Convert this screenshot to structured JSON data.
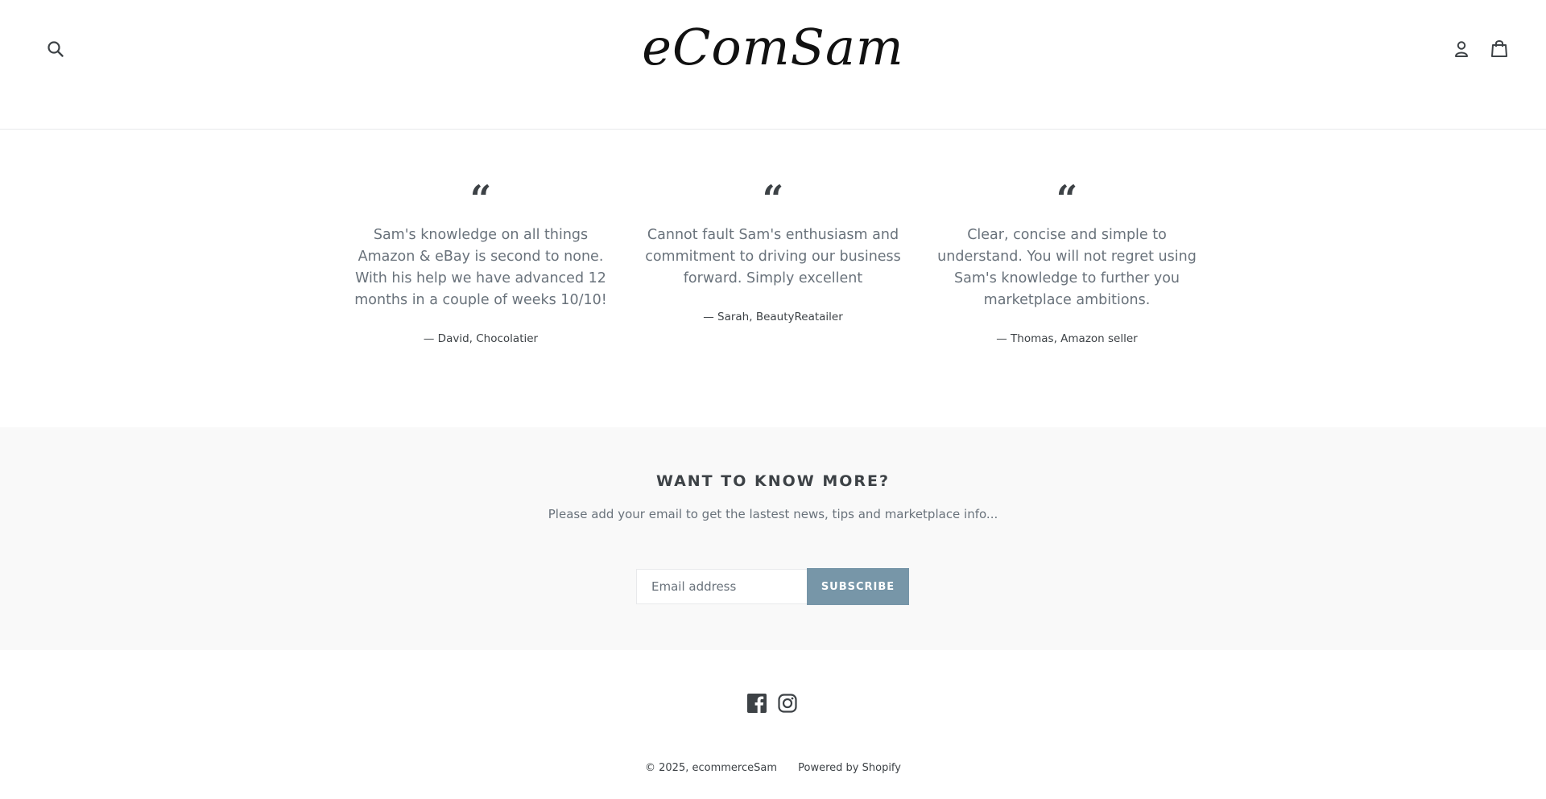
{
  "header": {
    "logo": "eComSam",
    "icons": {
      "search": "search-icon",
      "account": "user-icon",
      "cart": "cart-icon"
    }
  },
  "testimonials": [
    {
      "quote_mark": "“",
      "text": "Sam's knowledge on all things Amazon & eBay is second to none. With his help we have advanced 12 months in a couple of weeks 10/10!",
      "author": "— David, Chocolatier"
    },
    {
      "quote_mark": "“",
      "text": "Cannot fault Sam's enthusiasm and commitment to driving our business forward. Simply excellent",
      "author": "— Sarah, BeautyReatailer"
    },
    {
      "quote_mark": "“",
      "text": "Clear, concise and simple to understand. You will not regret using Sam's knowledge to further you marketplace ambitions.",
      "author": "— Thomas, Amazon seller"
    }
  ],
  "newsletter": {
    "title": "WANT TO KNOW MORE?",
    "subtitle": "Please add your email to get the lastest news, tips and marketplace info...",
    "email_placeholder": "Email address",
    "subscribe_label": "SUBSCRIBE"
  },
  "footer": {
    "social": [
      "facebook-icon",
      "instagram-icon"
    ],
    "copyright": "© 2025, ecommerceSam",
    "powered_by": "Powered by Shopify"
  },
  "colors": {
    "text": "#3d4246",
    "muted": "#69727b",
    "accent_button": "#7796a8",
    "newsletter_bg": "#f9f9f9"
  }
}
